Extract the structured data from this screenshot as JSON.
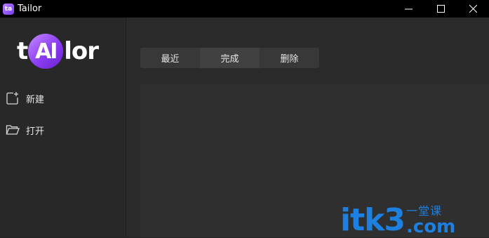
{
  "window": {
    "title": "Tailor",
    "app_icon_text": "ta",
    "controls": [
      "minimize-icon",
      "maximize-icon",
      "close-icon"
    ]
  },
  "sidebar": {
    "logo": {
      "prefix": "t",
      "highlight": "AI",
      "suffix": "lor"
    },
    "items": [
      {
        "label": "新建",
        "icon": "new-file-icon"
      },
      {
        "label": "打开",
        "icon": "folder-open-icon"
      }
    ]
  },
  "tabs": [
    {
      "label": "最近",
      "active": false
    },
    {
      "label": "完成",
      "active": true
    },
    {
      "label": "删除",
      "active": false
    }
  ],
  "watermark": {
    "main": "itk3",
    "cn": "一堂课",
    "com": ".com"
  },
  "colors": {
    "titlebar": "#000000",
    "sidebar": "#282828",
    "main": "#2a2a2a",
    "accent": "#8a3cf2",
    "watermark": "#1d7fe0"
  }
}
